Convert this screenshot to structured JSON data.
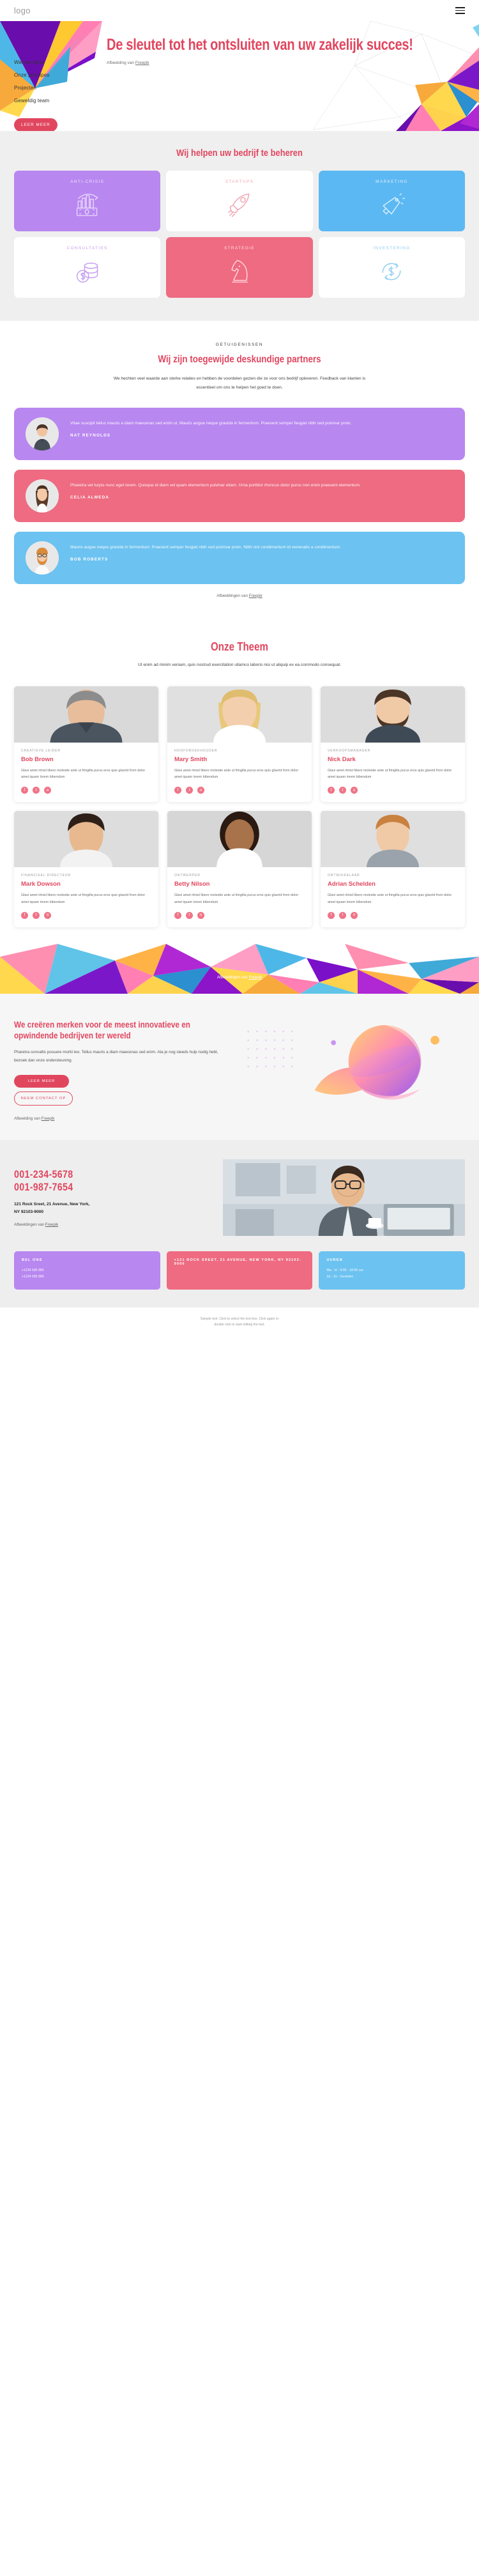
{
  "header": {
    "logo": "logo",
    "menu_icon": "hamburger-menu-icon"
  },
  "hero": {
    "nav": [
      {
        "label": "Wat we doen"
      },
      {
        "label": "Onze principes"
      },
      {
        "label": "Projecten"
      },
      {
        "label": "Geweldig team"
      }
    ],
    "cta": "LEER MEER",
    "title": "De sleutel tot het ontsluiten van uw zakelijk succes!",
    "credit_prefix": "Afbeelding van ",
    "credit_link": "Freepik"
  },
  "services": {
    "title": "Wij helpen uw bedrijf te beheren",
    "cards": [
      {
        "label": "ANTI-CRISIS",
        "icon": "money-chart-icon",
        "style": "c-purple"
      },
      {
        "label": "STARTUPS",
        "icon": "rocket-icon",
        "style": "c-white-pink"
      },
      {
        "label": "MARKETING",
        "icon": "megaphone-icon",
        "style": "c-blue"
      },
      {
        "label": "CONSULTATIES",
        "icon": "coins-dollar-icon",
        "style": "c-white-purple"
      },
      {
        "label": "STRATEGIE",
        "icon": "chess-knight-icon",
        "style": "c-pink"
      },
      {
        "label": "INVESTERING",
        "icon": "dollar-refresh-icon",
        "style": "c-white-blue"
      }
    ]
  },
  "testimonials": {
    "eyebrow": "GETUIGENISSEN",
    "title": "Wij zijn toegewijde deskundige partners",
    "subtitle": "We hechten veel waarde aan sterke relaties en hebben de voordelen gezien die ze voor ons bedrijf opleveren. Feedback van klanten is essentieel om ons te helpen het goed te doen.",
    "items": [
      {
        "quote": "Vitae suscipit tellus mauris a diam maecenas sed enim ut. Mauris augue neque gravida in fermentum. Praesent semper feugiat nibh sed pulvinar proin.",
        "name": "NAT REYNOLDS",
        "style": "t1"
      },
      {
        "quote": "Pharetra vel turpis nunc eget lorem. Quisque id diam vel quam elementum pulvinar etiam. Urna porttitor rhoncus dolor purus non enim praesent elementum.",
        "name": "CELIA ALMEDA",
        "style": "t2"
      },
      {
        "quote": "Mauris augue neque gravida in fermentum. Praesent semper feugiat nibh sed pulvinar proin. Nibh nisl condimentum id venenatis a condimentum.",
        "name": "BOB ROBERTS",
        "style": "t3"
      }
    ],
    "credit_prefix": "Afbeeldingen van ",
    "credit_link": "Freepik"
  },
  "team": {
    "title": "Onze Theem",
    "subtitle": "Ut enim ad minim veniam, quis nostrud exercitation ullamco laboris nisi ut aliquip ex ea commodo consequat.",
    "description": "Glavi amet ritnisl libero molestie ante ut fringilla purus eros quis glavrid from dolor amet iquam lorem bibendum",
    "members": [
      {
        "role": "CREATIEVE LEIDER",
        "name": "Bob Brown"
      },
      {
        "role": "HOOFDBOEKHOUDER",
        "name": "Mary Smith"
      },
      {
        "role": "VERKOOPSMANAGER",
        "name": "Nick Dark"
      },
      {
        "role": "FINANCIEEL DIRECTEUR",
        "name": "Mark Dowson"
      },
      {
        "role": "ONTWERPER",
        "name": "Betty Nilson"
      },
      {
        "role": "ONTWIKKELAAR",
        "name": "Adrian Schelden"
      }
    ],
    "socials": [
      {
        "name": "facebook-icon",
        "glyph": "f"
      },
      {
        "name": "twitter-icon",
        "glyph": "t"
      },
      {
        "name": "instagram-icon",
        "glyph": "o"
      }
    ],
    "credit_prefix": "Afbeeldingen van ",
    "credit_link": "Freepik"
  },
  "brands": {
    "title": "We creëren merken voor de meest innovatieve en opwindende bedrijven ter wereld",
    "text": "Pharetra convallis posuere morbi leo. Tellus mauris a diam maecenas sed enim. Ata je nog steeds hulp nodig hebt, bezoek dan onze ondersteuning.",
    "cta_primary": "LEER MEER",
    "cta_secondary": "NEEM CONTACT OP",
    "credit_prefix": "Afbeelding van ",
    "credit_link": "Freepik"
  },
  "contact": {
    "phone_1": "001-234-5678",
    "phone_2": "001-987-7654",
    "address_line_1": "121 Rock Sreet, 21 Avenue, New York,",
    "address_line_2": "NY 92103-9000",
    "credit_prefix": "Afbeeldingen van ",
    "credit_link": "Freepik",
    "cards": [
      {
        "heading": "BEL ONS",
        "lines": [
          "+1234 585 885",
          "+1234 585 886"
        ],
        "style": "i1"
      },
      {
        "heading": "+121 ROCK SREET, 21 AVENUE, NEW YORK, NY 92103-9000",
        "lines": [],
        "style": "i2"
      },
      {
        "heading": "UUREN",
        "lines": [
          "Ma - Vr : 9:00 - 18:00 uur",
          "Za - Zo : Gesloten"
        ],
        "style": "i3"
      }
    ]
  },
  "footer": {
    "line_1": "Sample text. Click to select the text box. Click again or",
    "line_2": "double click to start editing the text."
  },
  "colors": {
    "accent": "#e1465f",
    "purple": "#b887f0",
    "pink": "#ee6b81",
    "blue": "#6cc2f0"
  }
}
